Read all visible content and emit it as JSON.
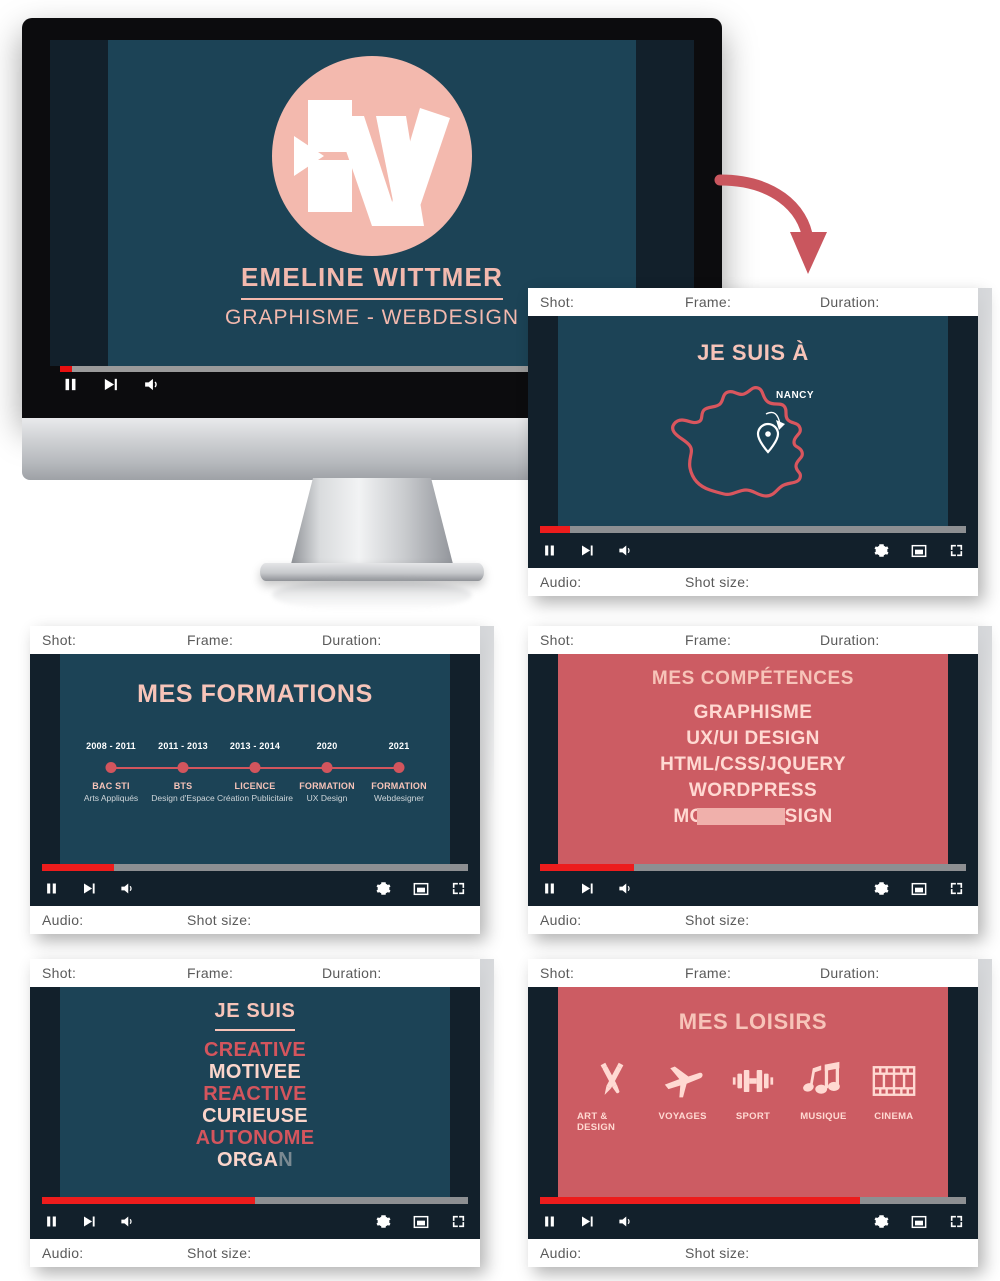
{
  "imac": {
    "brand_name": "EMELINE WITTMER",
    "brand_sub": "GRAPHISME - WEBDESIGN",
    "logo_icon": "ew-monogram-logo",
    "progress_percent": 2,
    "controls": [
      {
        "name": "pause-button",
        "label": "pause"
      },
      {
        "name": "next-button",
        "label": "next"
      },
      {
        "name": "volume-button",
        "label": "volume"
      },
      {
        "name": "settings-button",
        "label": "settings"
      }
    ],
    "colors": {
      "screen_bg": "#1c4356",
      "accent_pink": "#f3b9ae",
      "bezel": "#0c0c0e"
    }
  },
  "arrow": {
    "name": "curved-arrow",
    "color": "#c9565e"
  },
  "meta_labels": {
    "shot": "Shot:",
    "frame": "Frame:",
    "duration": "Duration:",
    "audio": "Audio:",
    "shot_size": "Shot size:"
  },
  "player_controls": [
    {
      "name": "pause-button",
      "label": "pause"
    },
    {
      "name": "next-button",
      "label": "next"
    },
    {
      "name": "volume-button",
      "label": "volume"
    },
    {
      "name": "settings-button",
      "label": "settings"
    },
    {
      "name": "miniplayer-button",
      "label": "miniplayer"
    },
    {
      "name": "fullscreen-button",
      "label": "fullscreen"
    }
  ],
  "colors": {
    "teal": "#1c4356",
    "red": "#cc5c63",
    "pink": "#f7c4b9",
    "progress_fill": "#ed1c1c",
    "progress_track": "#8d8f92",
    "letterbox": "#12202b"
  },
  "cards": [
    {
      "id": "card-je-suis-a",
      "theme": "teal",
      "title": "JE SUIS À",
      "progress_percent": 7,
      "map": {
        "icon": "france-map-outline",
        "pin_icon": "location-pin-icon",
        "pin_label": "NANCY"
      }
    },
    {
      "id": "card-mes-formations",
      "theme": "teal",
      "title": "MES FORMATIONS",
      "progress_percent": 17,
      "timeline": [
        {
          "year": "2008 - 2011",
          "name": "BAC STI",
          "desc": "Arts Appliqués"
        },
        {
          "year": "2011 - 2013",
          "name": "BTS",
          "desc": "Design d'Espace"
        },
        {
          "year": "2013 - 2014",
          "name": "LICENCE",
          "desc": "Création Publicitaire"
        },
        {
          "year": "2020",
          "name": "FORMATION",
          "desc": "UX Design"
        },
        {
          "year": "2021",
          "name": "FORMATION",
          "desc": "Webdesigner"
        }
      ]
    },
    {
      "id": "card-mes-competences",
      "theme": "red",
      "title": "MES COMPÉTENCES",
      "progress_percent": 22,
      "skills": [
        {
          "text": "GRAPHISME",
          "redacted": false
        },
        {
          "text": "UX/UI DESIGN",
          "redacted": false
        },
        {
          "text": "HTML/CSS/JQUERY",
          "redacted": false
        },
        {
          "text": "WORDPRESS",
          "redacted": false
        },
        {
          "text": "MOTION DESIGN",
          "redacted": true
        }
      ]
    },
    {
      "id": "card-je-suis",
      "theme": "teal",
      "title": "JE SUIS",
      "progress_percent": 50,
      "traits": [
        {
          "text": "CREATIVE",
          "style": "a",
          "cut": ""
        },
        {
          "text": "MOTIVEE",
          "style": "b",
          "cut": ""
        },
        {
          "text": "REACTIVE",
          "style": "a",
          "cut": ""
        },
        {
          "text": "CURIEUSE",
          "style": "b",
          "cut": ""
        },
        {
          "text": "AUTONOME",
          "style": "a",
          "cut": ""
        },
        {
          "text": "ORGA",
          "style": "b",
          "cut": "N"
        }
      ]
    },
    {
      "id": "card-mes-loisirs",
      "theme": "red",
      "title": "MES LOISIRS",
      "progress_percent": 75,
      "hobbies": [
        {
          "label": "ART & DESIGN",
          "icon": "pencil-brush-cross-icon"
        },
        {
          "label": "VOYAGES",
          "icon": "airplane-icon"
        },
        {
          "label": "SPORT",
          "icon": "dumbbell-icon"
        },
        {
          "label": "MUSIQUE",
          "icon": "music-notes-icon"
        },
        {
          "label": "CINEMA",
          "icon": "film-strip-icon"
        }
      ]
    }
  ]
}
